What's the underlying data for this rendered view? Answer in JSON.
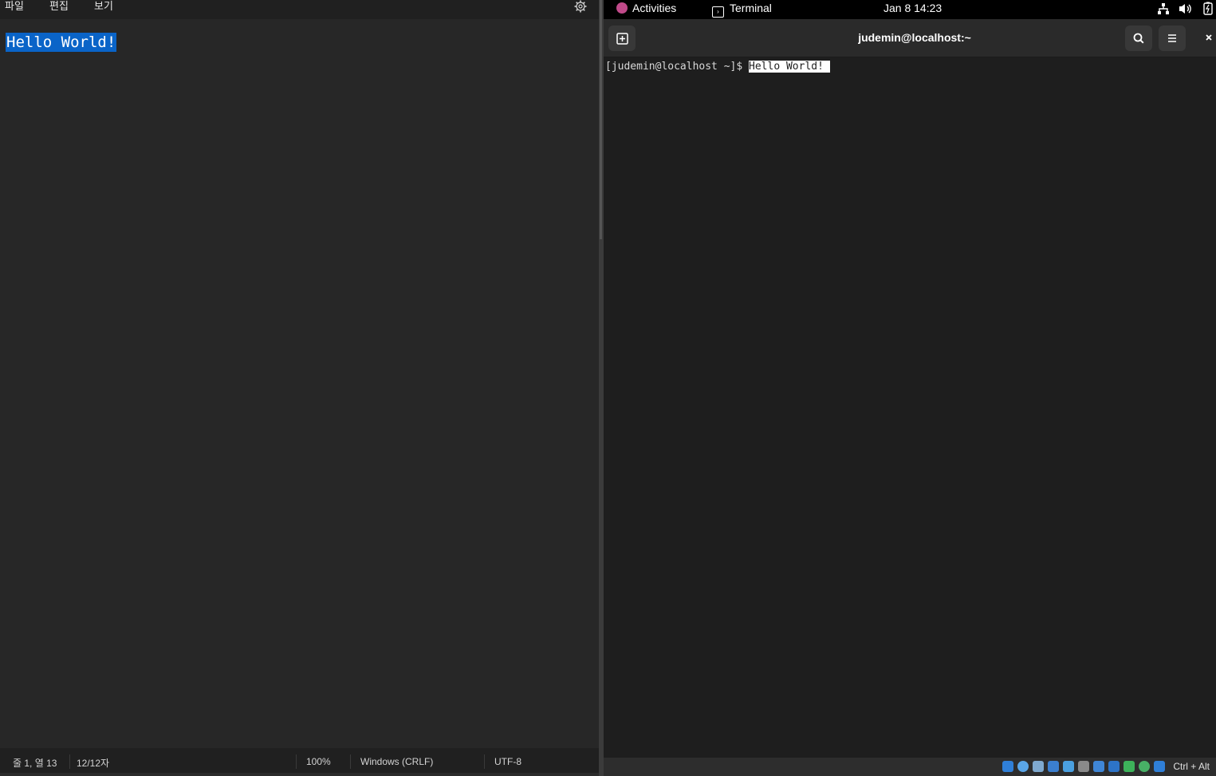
{
  "notepad": {
    "menu": {
      "file": "파일",
      "edit": "편집",
      "view": "보기"
    },
    "content": "Hello World!",
    "status": {
      "position": "줄 1, 열 13",
      "chars": "12/12자",
      "zoom": "100%",
      "line_ending": "Windows (CRLF)",
      "encoding": "UTF-8"
    }
  },
  "gnome": {
    "activities": "Activities",
    "app_name": "Terminal",
    "clock": "Jan 8  14:23"
  },
  "terminal": {
    "title": "judemin@localhost:~",
    "prompt": "[judemin@localhost ~]$ ",
    "selected_text": "Hello World! "
  },
  "vbox": {
    "host_key": "Ctrl + Alt"
  },
  "colors": {
    "selection": "#0a64c8",
    "notepad_bg": "#272727",
    "terminal_bg": "#1e1e1e"
  }
}
